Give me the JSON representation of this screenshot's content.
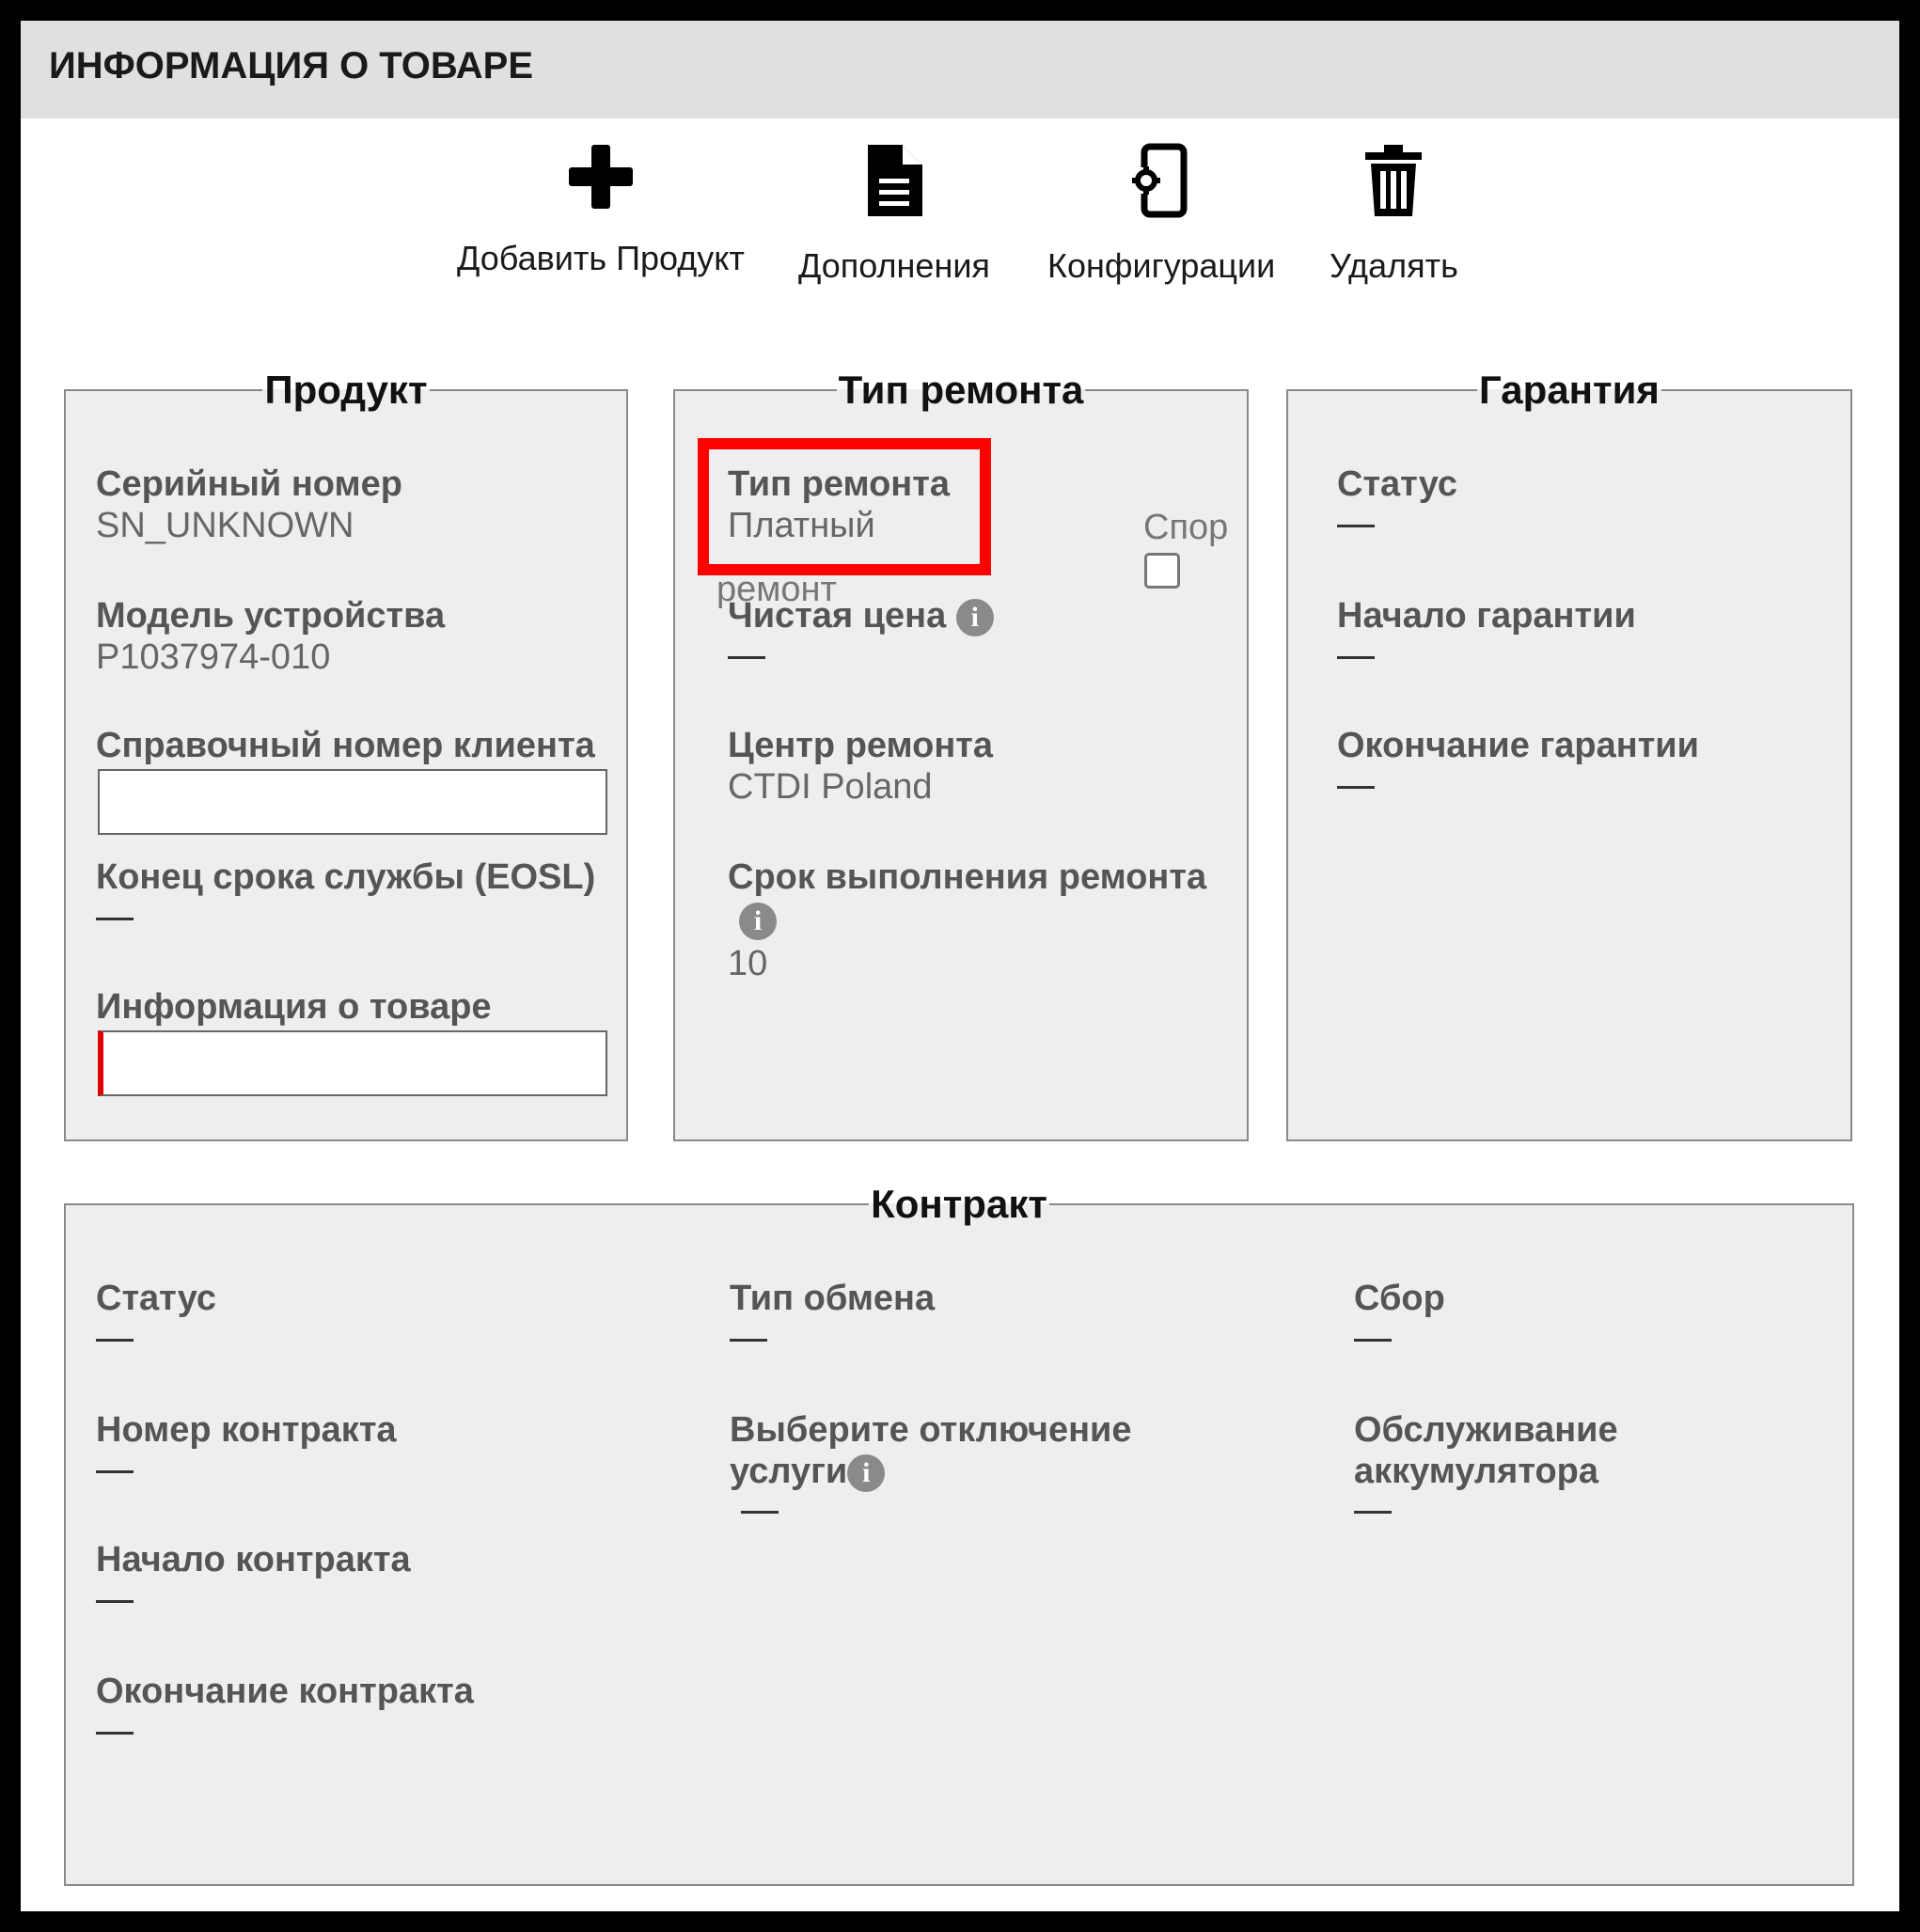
{
  "header": {
    "title": "ИНФОРМАЦИЯ О ТОВАРЕ"
  },
  "toolbar": {
    "add_product": {
      "label": "Добавить Продукт",
      "icon": "plus-icon"
    },
    "addons": {
      "label": "Дополнения",
      "icon": "document-icon"
    },
    "configurations": {
      "label": "Конфигурации",
      "icon": "device-settings-icon"
    },
    "delete": {
      "label": "Удалять",
      "icon": "trash-icon"
    }
  },
  "product": {
    "legend": "Продукт",
    "serial_label": "Серийный номер",
    "serial_value": "SN_UNKNOWN",
    "model_label": "Модель устройства",
    "model_value": "P1037974-010",
    "client_ref_label": "Справочный номер клиента",
    "client_ref_value": "",
    "eosl_label": "Конец срока службы (EOSL)",
    "eosl_value": "—",
    "product_info_label": "Информация о товаре",
    "product_info_value": ""
  },
  "repair": {
    "legend": "Тип ремонта",
    "type_label": "Тип ремонта",
    "type_value": "Платный",
    "disputed_label": "Спор",
    "disputed_label_overflow": "ремонт",
    "net_price_label": "Чистая цена",
    "net_price_value": "—",
    "center_label": "Центр ремонта",
    "center_value": "CTDI Poland",
    "turnaround_label": "Срок выполнения ремонта",
    "turnaround_value": "10",
    "info_glyph": "i"
  },
  "warranty": {
    "legend": "Гарантия",
    "status_label": "Статус",
    "status_value": "—",
    "start_label": "Начало гарантии",
    "start_value": "—",
    "end_label": "Окончание гарантии",
    "end_value": "—"
  },
  "contract": {
    "legend": "Контракт",
    "status_label": "Статус",
    "status_value": "—",
    "number_label": "Номер контракта",
    "number_value": "—",
    "start_label": "Начало контракта",
    "start_value": "—",
    "end_label": "Окончание контракта",
    "end_value": "—",
    "exchange_label": "Тип обмена",
    "exchange_value": "—",
    "service_off_label_line1": "Выберите отключение",
    "service_off_label_line2": "услуги",
    "service_off_value": "—",
    "fee_label": "Сбор",
    "fee_value": "—",
    "battery_label_line1": "Обслуживание",
    "battery_label_line2": "аккумулятора",
    "battery_value": "—"
  },
  "colors": {
    "highlight": "#ff0000",
    "panel_bg": "#eeeeee",
    "header_bg": "#e0e0e0",
    "required_marker": "#e00000"
  }
}
